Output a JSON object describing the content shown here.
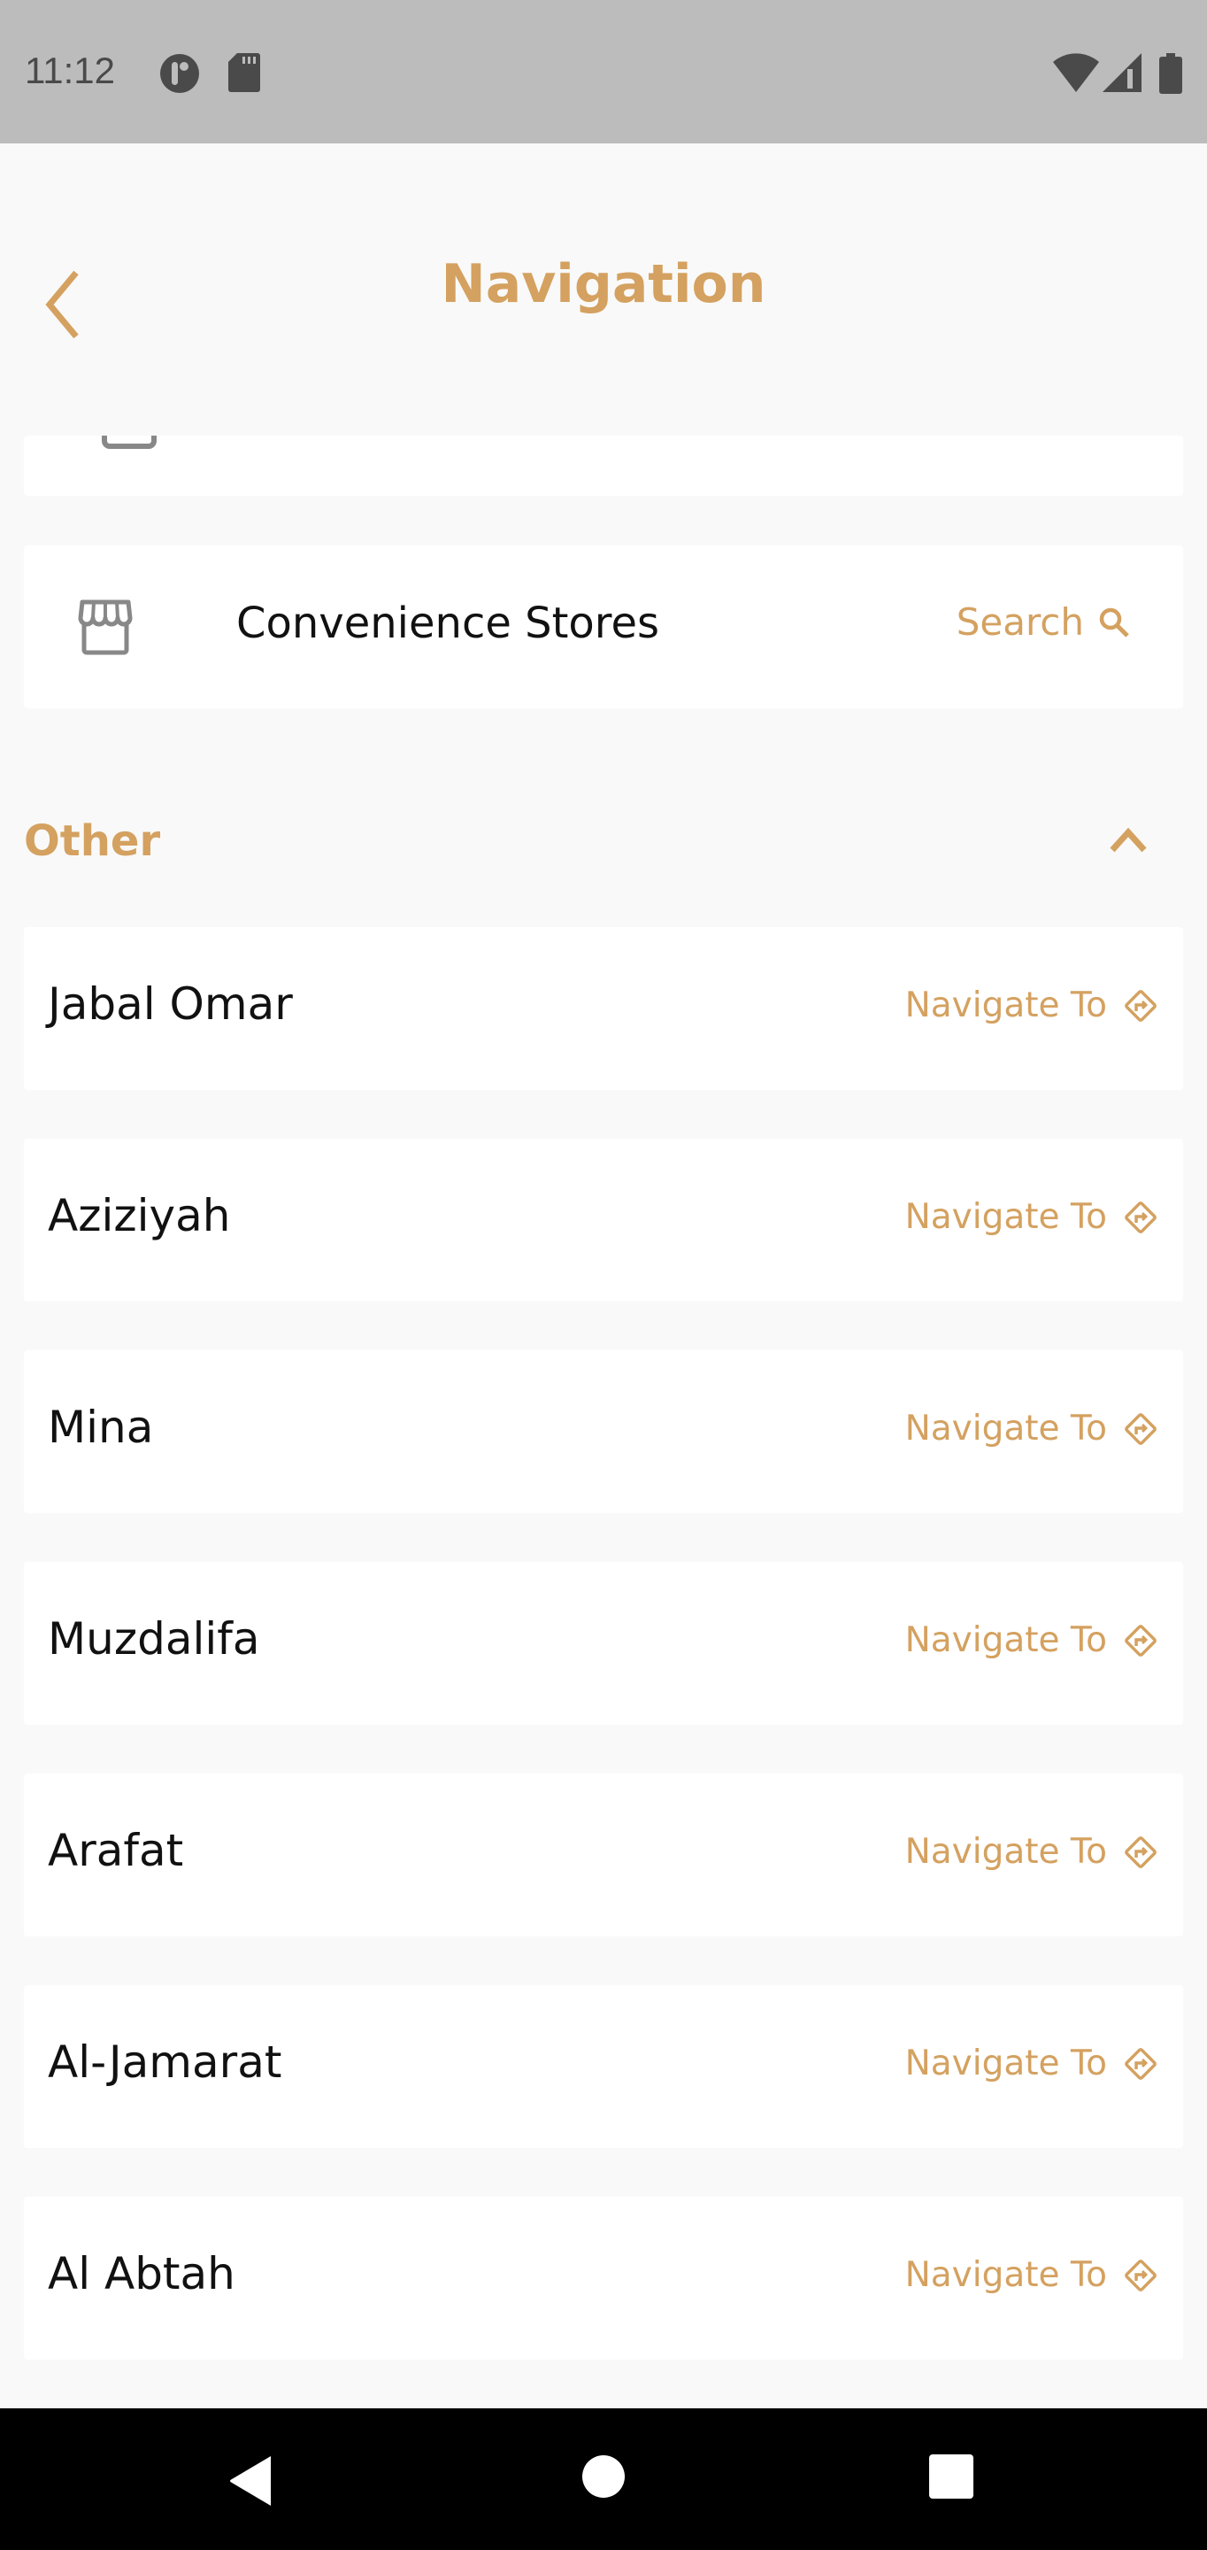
{
  "status_bar": {
    "time": "11:12",
    "left_icons": [
      "data-saver-icon",
      "sd-card-icon"
    ],
    "right_icons": [
      "wifi-icon",
      "signal-icon",
      "battery-icon"
    ]
  },
  "header": {
    "back_icon": "chevron-left-icon",
    "title": "Navigation"
  },
  "services": [
    {
      "label": "Convenience Stores",
      "icon": "store-icon",
      "action_label": "Search",
      "action_icon": "search-icon"
    }
  ],
  "section": {
    "title": "Other",
    "expanded": true,
    "toggle_icon": "chevron-up-icon"
  },
  "places": [
    {
      "name": "Jabal Omar",
      "action_label": "Navigate To"
    },
    {
      "name": "Aziziyah",
      "action_label": "Navigate To"
    },
    {
      "name": "Mina",
      "action_label": "Navigate To"
    },
    {
      "name": "Muzdalifa",
      "action_label": "Navigate To"
    },
    {
      "name": "Arafat",
      "action_label": "Navigate To"
    },
    {
      "name": "Al-Jamarat",
      "action_label": "Navigate To"
    },
    {
      "name": "Al Abtah",
      "action_label": "Navigate To"
    }
  ],
  "colors": {
    "accent": "#d4a160",
    "background": "#f9f9f9",
    "card": "#ffffff",
    "status_bar": "#bcbcbc",
    "nav_bar": "#000000"
  },
  "system_nav": [
    "back-button",
    "home-button",
    "recents-button"
  ]
}
